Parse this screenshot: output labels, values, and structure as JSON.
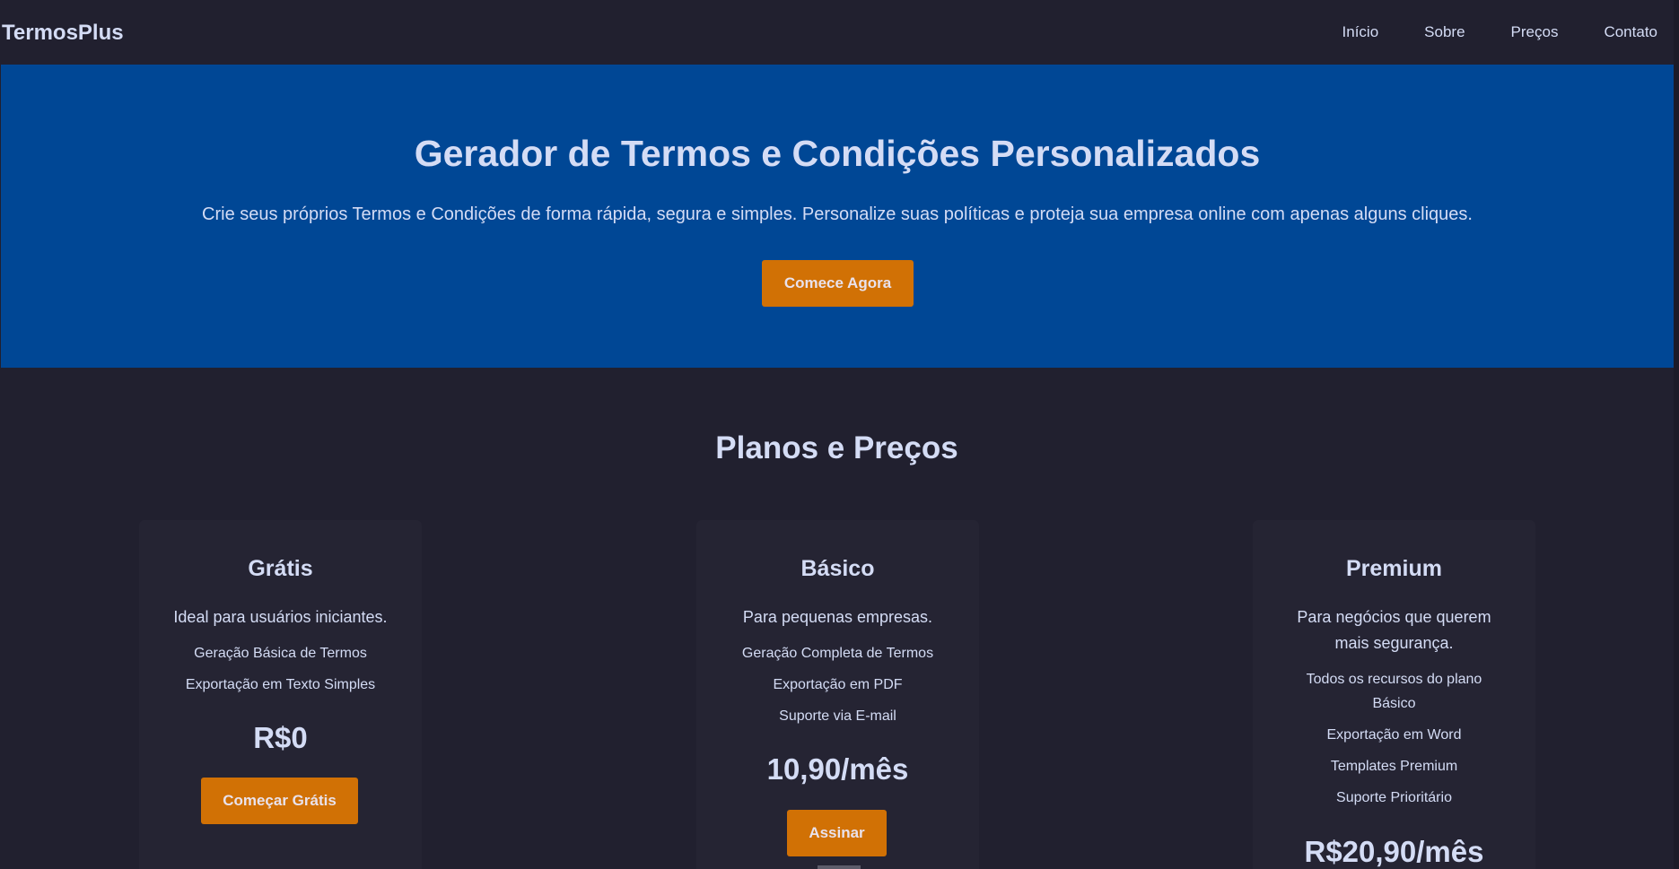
{
  "header": {
    "brand": "TermosPlus",
    "nav": [
      "Início",
      "Sobre",
      "Preços",
      "Contato"
    ]
  },
  "hero": {
    "title": "Gerador de Termos e Condições Personalizados",
    "subtitle": "Crie seus próprios Termos e Condições de forma rápida, segura e simples. Personalize suas políticas e proteja sua empresa online com apenas alguns cliques.",
    "cta": "Comece Agora"
  },
  "pricing": {
    "title": "Planos e Preços",
    "plans": [
      {
        "name": "Grátis",
        "description": "Ideal para usuários iniciantes.",
        "features": [
          "Geração Básica de Termos",
          "Exportação em Texto Simples"
        ],
        "price": "R$0",
        "button": "Começar Grátis"
      },
      {
        "name": "Básico",
        "description": "Para pequenas empresas.",
        "features": [
          "Geração Completa de Termos",
          "Exportação em PDF",
          "Suporte via E-mail"
        ],
        "price": "10,90/mês",
        "button": "Assinar"
      },
      {
        "name": "Premium",
        "description": "Para negócios que querem mais segurança.",
        "features": [
          "Todos os recursos do plano Básico",
          "Exportação em Word",
          "Templates Premium",
          "Suporte Prioritário"
        ],
        "price": "R$20,90/mês",
        "button": ""
      }
    ]
  },
  "colors": {
    "background": "#21202f",
    "hero": "#004795",
    "accent": "#d17105",
    "text": "#d4dcf5",
    "card": "#252433"
  }
}
